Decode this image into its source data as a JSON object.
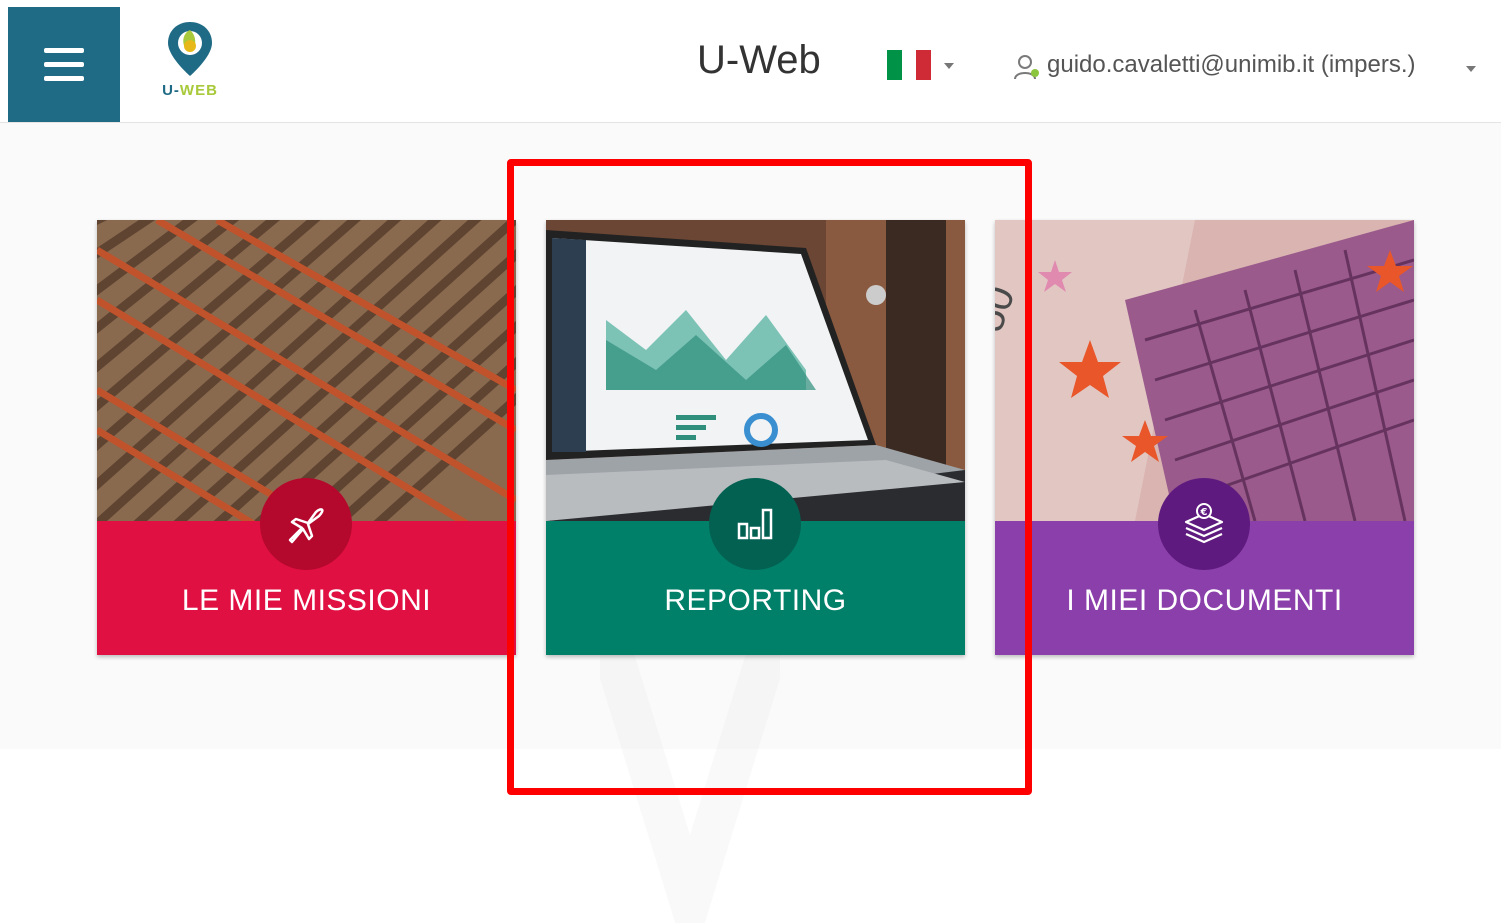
{
  "header": {
    "app_title": "U-Web",
    "logo_text_left": "U-",
    "logo_text_right": "WEB",
    "language": "Italian flag",
    "user_label": "guido.cavaletti@unimib.it (impers.)"
  },
  "tiles": [
    {
      "label": "LE MIE MISSIONI",
      "icon": "airplane-icon",
      "color": "#e01042",
      "circle_color": "#b5082d"
    },
    {
      "label": "REPORTING",
      "icon": "bar-chart-icon",
      "color": "#008069",
      "circle_color": "#036152"
    },
    {
      "label": "I MIEI DOCUMENTI",
      "icon": "euro-stack-icon",
      "color": "#8b3faa",
      "circle_color": "#5e1a7e"
    }
  ],
  "highlight": {
    "target": "REPORTING",
    "color": "#ff0000"
  },
  "colors": {
    "menu": "#1f6b85",
    "logo_accent": "#a8c93a"
  }
}
